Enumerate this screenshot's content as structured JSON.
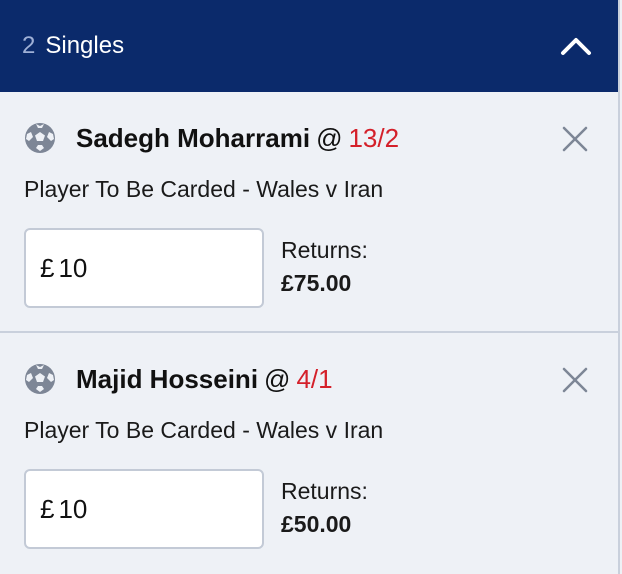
{
  "header": {
    "count": "2",
    "title": "Singles"
  },
  "bets": [
    {
      "selection": "Sadegh Moharrami",
      "at": "@",
      "odds": "13/2",
      "market": "Player To Be Carded - Wales v Iran",
      "currency": "£",
      "stake": "10",
      "returns_label": "Returns:",
      "returns_value": "£75.00"
    },
    {
      "selection": "Majid Hosseini",
      "at": "@",
      "odds": "4/1",
      "market": "Player To Be Carded - Wales v Iran",
      "currency": "£",
      "stake": "10",
      "returns_label": "Returns:",
      "returns_value": "£50.00"
    }
  ],
  "icons": {
    "sport": "football-icon",
    "remove": "close-icon",
    "collapse": "chevron-up-icon"
  },
  "colors": {
    "header_bg": "#0b2a6b",
    "odds": "#d4202a"
  }
}
